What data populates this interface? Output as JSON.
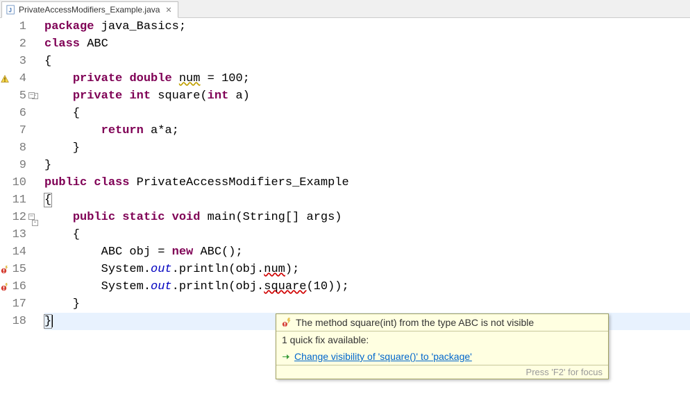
{
  "tab": {
    "filename": "PrivateAccessModifiers_Example.java",
    "close_glyph": "✕"
  },
  "code": {
    "lines": [
      {
        "n": 1,
        "html": "<span class='kw'>package</span> <span class='pkg'>java_Basics</span>;"
      },
      {
        "n": 2,
        "html": "<span class='kw'>class</span> ABC"
      },
      {
        "n": 3,
        "html": "{"
      },
      {
        "n": 4,
        "html": "    <span class='kw'>private</span> <span class='kw'>double</span> <span class='warn-underline'>num</span> = 100;",
        "marker": "warn-bulb"
      },
      {
        "n": 5,
        "html": "    <span class='kw'>private</span> <span class='kw'>int</span> square(<span class='kw'>int</span> a)",
        "fold": true
      },
      {
        "n": 6,
        "html": "    {"
      },
      {
        "n": 7,
        "html": "        <span class='kw'>return</span> a*a;"
      },
      {
        "n": 8,
        "html": "    }"
      },
      {
        "n": 9,
        "html": "}"
      },
      {
        "n": 10,
        "html": "<span class='kw'>public</span> <span class='kw'>class</span> PrivateAccessModifiers_Example"
      },
      {
        "n": 11,
        "html": "<span class='box-bracket'>{</span>"
      },
      {
        "n": 12,
        "html": "    <span class='kw'>public</span> <span class='kw'>static</span> <span class='kw'>void</span> main(String[] args)",
        "fold": true
      },
      {
        "n": 13,
        "html": "    {"
      },
      {
        "n": 14,
        "html": "        ABC obj = <span class='kw'>new</span> ABC();"
      },
      {
        "n": 15,
        "html": "        System.<span class='field-static'>out</span>.println(obj.<span class='err-underline'>num</span>);",
        "marker": "error-bulb"
      },
      {
        "n": 16,
        "html": "        System.<span class='field-static'>out</span>.println(obj.<span class='err-underline'>square</span>(10));",
        "marker": "error-bulb"
      },
      {
        "n": 17,
        "html": "    }"
      },
      {
        "n": 18,
        "html": "<span class='box-bracket'>}</span><span class='cursor-caret'></span>",
        "current": true
      }
    ]
  },
  "hover": {
    "error_msg": "The method square(int) from the type ABC is not visible",
    "quickfix_header": "1 quick fix available:",
    "quickfix_link": "Change visibility of 'square()' to 'package'",
    "footer": "Press 'F2' for focus"
  }
}
